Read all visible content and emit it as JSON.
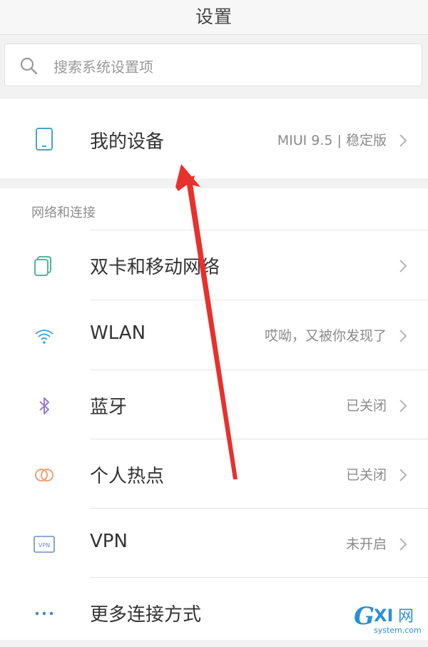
{
  "header": {
    "title": "设置"
  },
  "search": {
    "placeholder": "搜索系统设置项",
    "icon": "search-icon"
  },
  "device": {
    "label": "我的设备",
    "value": "MIUI 9.5 | 稳定版",
    "icon": "phone-icon"
  },
  "network_section": {
    "title": "网络和连接",
    "items": [
      {
        "label": "双卡和移动网络",
        "value": "",
        "icon": "dual-sim-icon",
        "icon_color": "#4fb79a"
      },
      {
        "label": "WLAN",
        "value": "哎呦，又被你发现了",
        "icon": "wifi-icon",
        "icon_color": "#4aa3df"
      },
      {
        "label": "蓝牙",
        "value": "已关闭",
        "icon": "bluetooth-icon",
        "icon_color": "#9b7ad6"
      },
      {
        "label": "个人热点",
        "value": "已关闭",
        "icon": "hotspot-icon",
        "icon_color": "#f0a070"
      },
      {
        "label": "VPN",
        "value": "未开启",
        "icon": "vpn-icon",
        "icon_color": "#6b8fc9"
      },
      {
        "label": "更多连接方式",
        "value": "",
        "icon": "more-icon",
        "icon_color": "#4a7fc9"
      }
    ]
  },
  "annotation": {
    "arrow_color": "#e8302c"
  },
  "watermark": {
    "brand": "GXI网",
    "site": "system.com"
  }
}
